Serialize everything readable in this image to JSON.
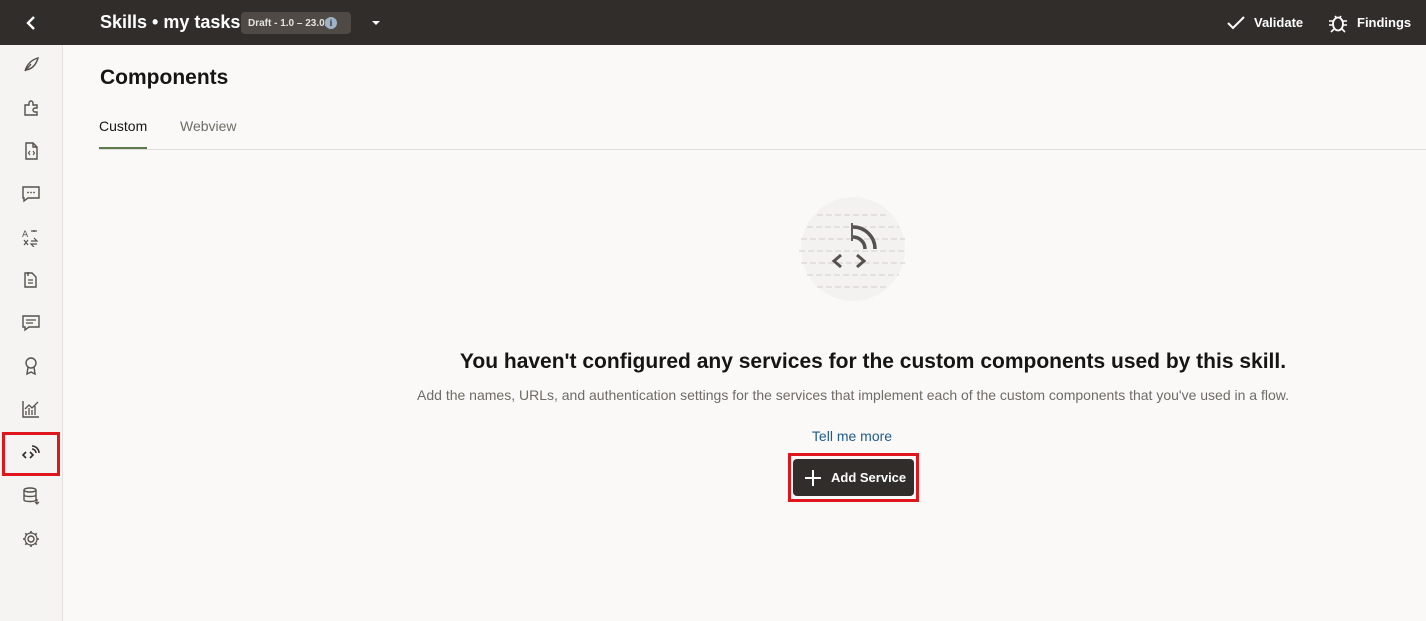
{
  "header": {
    "title": "Skills • my tasks",
    "version_badge": "Draft - 1.0 – 23.02",
    "info_icon": "info-icon",
    "validate_label": "Validate",
    "findings_label": "Findings"
  },
  "rail": {
    "items": [
      {
        "icon": "feather-icon"
      },
      {
        "icon": "puzzle-icon"
      },
      {
        "icon": "code-file-icon"
      },
      {
        "icon": "chat-icon"
      },
      {
        "icon": "translate-icon"
      },
      {
        "icon": "documents-icon"
      },
      {
        "icon": "conversation-icon"
      },
      {
        "icon": "award-icon"
      },
      {
        "icon": "analytics-icon"
      },
      {
        "icon": "components-icon",
        "active": true
      },
      {
        "icon": "database-icon"
      },
      {
        "icon": "settings-icon"
      }
    ]
  },
  "page": {
    "title": "Components",
    "tabs": [
      {
        "label": "Custom",
        "active": true
      },
      {
        "label": "Webview",
        "active": false
      }
    ]
  },
  "empty_state": {
    "heading": "You haven't configured any services for the custom components used by this skill.",
    "description": "Add the names, URLs, and authentication settings for the services that implement each of the custom components that you've used in a flow.",
    "link_label": "Tell me more",
    "button_label": "Add Service"
  },
  "colors": {
    "header_bg": "#312d2a",
    "highlight": "#e0161e",
    "link": "#1e5b8e",
    "tab_underline": "#5d7a4d"
  }
}
